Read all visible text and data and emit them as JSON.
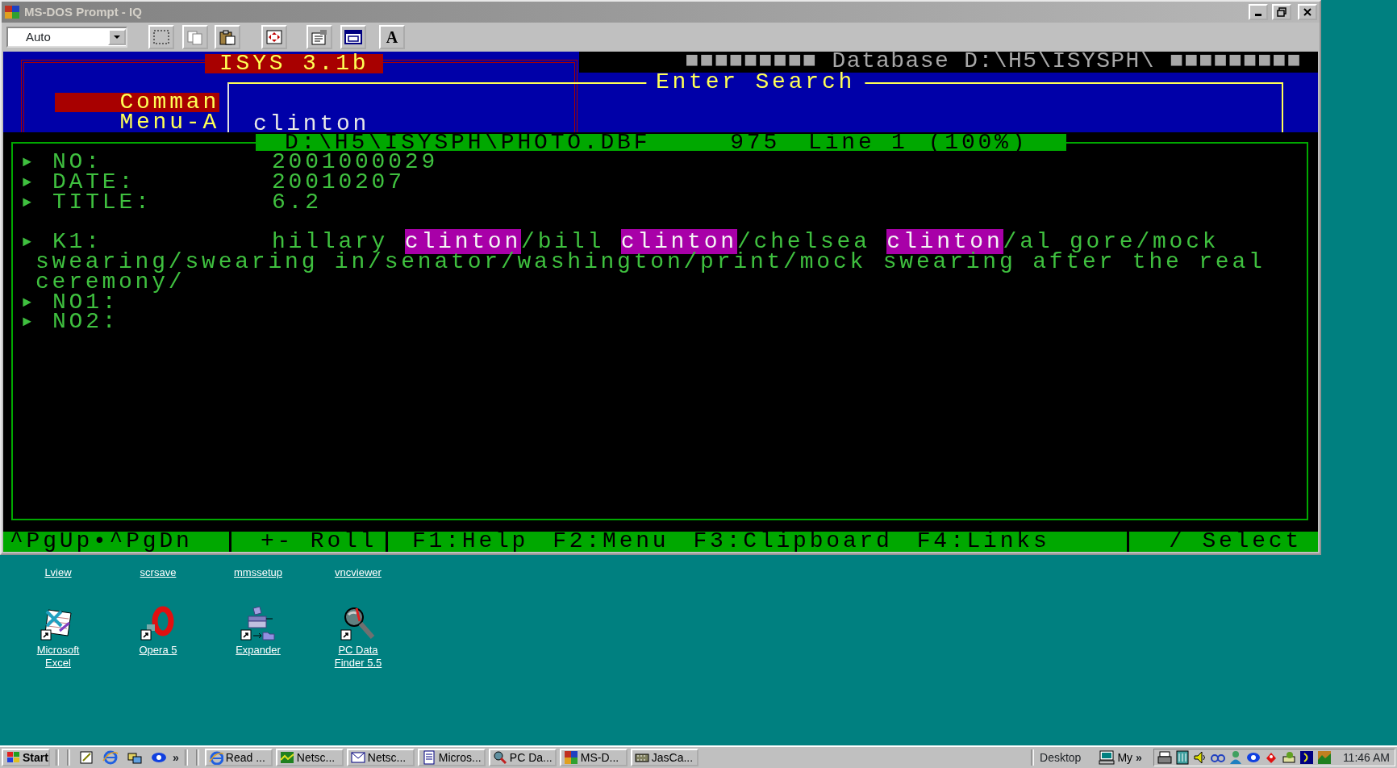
{
  "window": {
    "title": "MS-DOS Prompt - IQ"
  },
  "toolbar": {
    "size_dropdown": {
      "value": "Auto"
    },
    "font_button": "A"
  },
  "dos_screen": {
    "app_title": "ISYS 3.1b",
    "database_header": "■■■■■■■■■ Database D:\\H5\\ISYSPH\\ ■■■■■■■■■",
    "menu_labels": [
      {
        "text": "Comman",
        "selected": true
      },
      {
        "text": "Menu-A",
        "selected": false
      }
    ],
    "search": {
      "title": "Enter Search",
      "value": "clinton"
    },
    "file_bar": {
      "path": "D:\\H5\\ISYSPH\\PHOTO.DBF",
      "count": "975",
      "line": "Line 1",
      "percent": "(100%)"
    },
    "fields": [
      {
        "kind": "field",
        "marker": "►",
        "label": "NO:",
        "value": [
          {
            "text": "2001000029",
            "highlighted": false
          }
        ]
      },
      {
        "kind": "field",
        "marker": "►",
        "label": "DATE:",
        "value": [
          {
            "text": "20010207",
            "highlighted": false
          }
        ]
      },
      {
        "kind": "field",
        "marker": "►",
        "label": "TITLE:",
        "value": [
          {
            "text": "6.2",
            "highlighted": false
          }
        ]
      },
      {
        "kind": "blank"
      },
      {
        "kind": "field",
        "marker": "►",
        "label": "K1:",
        "value": [
          {
            "text": "hillary ",
            "highlighted": false
          },
          {
            "text": "clinton",
            "highlighted": true
          },
          {
            "text": "/bill ",
            "highlighted": false
          },
          {
            "text": "clinton",
            "highlighted": true
          },
          {
            "text": "/chelsea ",
            "highlighted": false
          },
          {
            "text": "clinton",
            "highlighted": true
          },
          {
            "text": "/al gore/mock swearing/swearing in/senator/washington/print/mock swearing after the real ceremony/",
            "highlighted": false
          }
        ]
      },
      {
        "kind": "field",
        "marker": "►",
        "label": "NO1:"
      },
      {
        "kind": "field",
        "marker": "►",
        "label": "NO2:"
      }
    ],
    "status_groups": [
      [
        "^PgUp•^PgDn"
      ],
      [
        "+- Roll"
      ],
      [
        "F1:Help",
        "F2:Menu",
        "F3:Clipboard",
        "F4:Links"
      ],
      [
        "/ Select"
      ]
    ]
  },
  "desktop_icons": [
    {
      "label": "Lview",
      "kind": "covered"
    },
    {
      "label": "scrsave",
      "kind": "covered"
    },
    {
      "label": "mmssetup",
      "kind": "covered"
    },
    {
      "label": "vncviewer",
      "kind": "covered"
    },
    {
      "label": "Microsoft Excel",
      "kind": "spreadsheet"
    },
    {
      "label": "Opera 5",
      "kind": "ring"
    },
    {
      "label": "Expander",
      "kind": "machine"
    },
    {
      "label": "PC Data Finder 5.5",
      "kind": "magnifier"
    }
  ],
  "taskbar": {
    "start": "Start",
    "quick_launch_more": "»",
    "tasks": [
      "Read ...",
      "Netsc...",
      "Netsc...",
      "Micros...",
      "PC Da...",
      "MS-D...",
      "JasCa..."
    ],
    "desktop_toolbar": "Desktop",
    "my_computer": "My",
    "toolbar_more": "»",
    "clock": "11:46 AM"
  }
}
